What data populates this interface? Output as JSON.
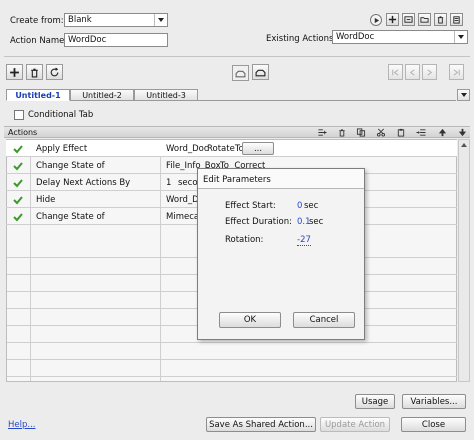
{
  "header": {
    "create_from_label": "Create from:",
    "create_from_value": "Blank",
    "action_name_label": "Action Name:",
    "action_name_value": "WordDoc",
    "existing_actions_label": "Existing Actions:",
    "existing_actions_value": "WordDoc"
  },
  "tabs": [
    {
      "label": "Untitled-1"
    },
    {
      "label": "Untitled-2"
    },
    {
      "label": "Untitled-3"
    }
  ],
  "conditional_tab_label": "Conditional Tab",
  "actions_header": "Actions",
  "rows": [
    {
      "action": "Apply Effect",
      "target": "Word_Doc",
      "detail": "RotateTo",
      "has_button": true,
      "button_label": "..."
    },
    {
      "action": "Change State of",
      "target": "File_Info_Box",
      "detail": "To  Correct"
    },
    {
      "action": "Delay Next Actions By",
      "target": "1",
      "detail": "secor"
    },
    {
      "action": "Hide",
      "target": "Word_Do",
      "detail": ""
    },
    {
      "action": "Change State of",
      "target": "Mimecast",
      "detail": ""
    }
  ],
  "dialog": {
    "title": "Edit Parameters",
    "effect_start_label": "Effect Start:",
    "effect_start_value": "0",
    "effect_start_unit": "sec",
    "effect_duration_label": "Effect Duration:",
    "effect_duration_value": "0.1",
    "effect_duration_unit": "sec",
    "rotation_label": "Rotation:",
    "rotation_value": "-27",
    "ok_label": "OK",
    "cancel_label": "Cancel"
  },
  "footer": {
    "usage_label": "Usage",
    "variables_label": "Variables...",
    "help_label": "Help...",
    "save_shared_label": "Save As Shared Action...",
    "update_action_label": "Update Action",
    "close_label": "Close"
  },
  "colors": {
    "check_green": "#3a9a2a",
    "link_blue": "#2848c8"
  }
}
